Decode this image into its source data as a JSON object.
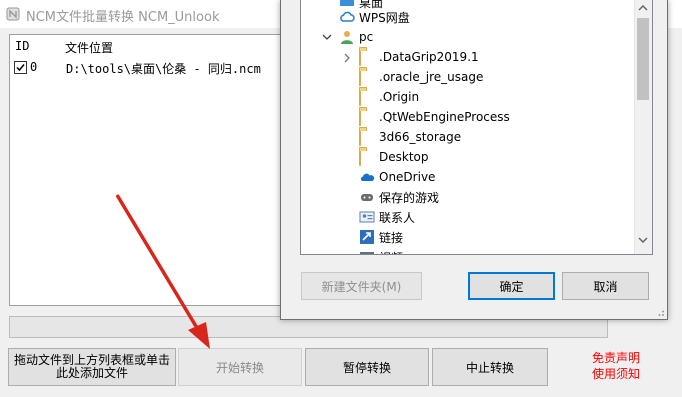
{
  "window": {
    "title": "NCM文件批量转换 NCM_Unlook"
  },
  "list": {
    "columns": [
      "ID",
      "文件位置"
    ],
    "rows": [
      {
        "checked": true,
        "id": "0",
        "path": "D:\\tools\\桌面\\伦桑 - 同归.ncm"
      }
    ]
  },
  "buttons": {
    "drag_add": "拖动文件到上方列表框或单击此处添加文件",
    "start": "开始转换",
    "pause": "暂停转换",
    "stop": "中止转换"
  },
  "links": {
    "disclaimer": "免责声明",
    "help": "使用须知"
  },
  "dialog": {
    "tree": [
      {
        "label": "桌面",
        "icon": "desktop-icon"
      },
      {
        "label": "WPS网盘",
        "icon": "cloud-icon"
      },
      {
        "label": "pc",
        "icon": "user-icon",
        "expanded": true
      },
      {
        "label": ".DataGrip2019.1",
        "icon": "folder-icon",
        "expandable": true
      },
      {
        "label": ".oracle_jre_usage",
        "icon": "folder-icon"
      },
      {
        "label": ".Origin",
        "icon": "folder-icon"
      },
      {
        "label": ".QtWebEngineProcess",
        "icon": "folder-icon"
      },
      {
        "label": "3d66_storage",
        "icon": "folder-icon"
      },
      {
        "label": "Desktop",
        "icon": "folder-icon"
      },
      {
        "label": "OneDrive",
        "icon": "onedrive-icon"
      },
      {
        "label": "保存的游戏",
        "icon": "saved-games-icon"
      },
      {
        "label": "联系人",
        "icon": "contacts-icon"
      },
      {
        "label": "链接",
        "icon": "links-icon"
      },
      {
        "label": "视频",
        "icon": "video-icon"
      }
    ],
    "new_folder": "新建文件夹(M)",
    "ok": "确定",
    "cancel": "取消"
  },
  "colors": {
    "accent": "#0078d7",
    "link_red": "#ff0000",
    "arrow": "#d9261c"
  }
}
